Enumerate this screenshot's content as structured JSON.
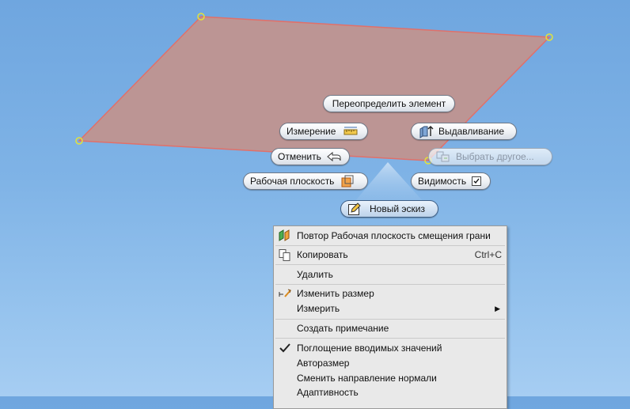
{
  "scene": {
    "plane_fill": "#c0948f",
    "plane_edge": "#e0706a",
    "vertex_color": "#e4e238",
    "background_top": "#6fa6df",
    "background_bottom": "#a6cdf2"
  },
  "marking_menu": {
    "redefine": "Переопределить элемент",
    "measure": "Измерение",
    "extrude": "Выдавливание",
    "undo": "Отменить",
    "select_other": "Выбрать другое...",
    "work_plane": "Рабочая плоскость",
    "visibility": "Видимость",
    "new_sketch": "Новый эскиз"
  },
  "context_menu": {
    "items": [
      {
        "label": "Повтор Рабочая плоскость смещения грани",
        "icon": "repeat-work-plane-icon"
      },
      {
        "label": "Копировать",
        "shortcut": "Ctrl+C",
        "icon": "copy-icon"
      },
      {
        "label": "Удалить"
      },
      {
        "label": "Изменить размер",
        "icon": "resize-icon"
      },
      {
        "label": "Измерить",
        "submenu": true
      },
      {
        "label": "Создать примечание"
      },
      {
        "label": "Поглощение вводимых значений",
        "checked": true
      },
      {
        "label": "Авторазмер"
      },
      {
        "label": "Сменить направление нормали"
      },
      {
        "label": "Адаптивность"
      }
    ]
  }
}
